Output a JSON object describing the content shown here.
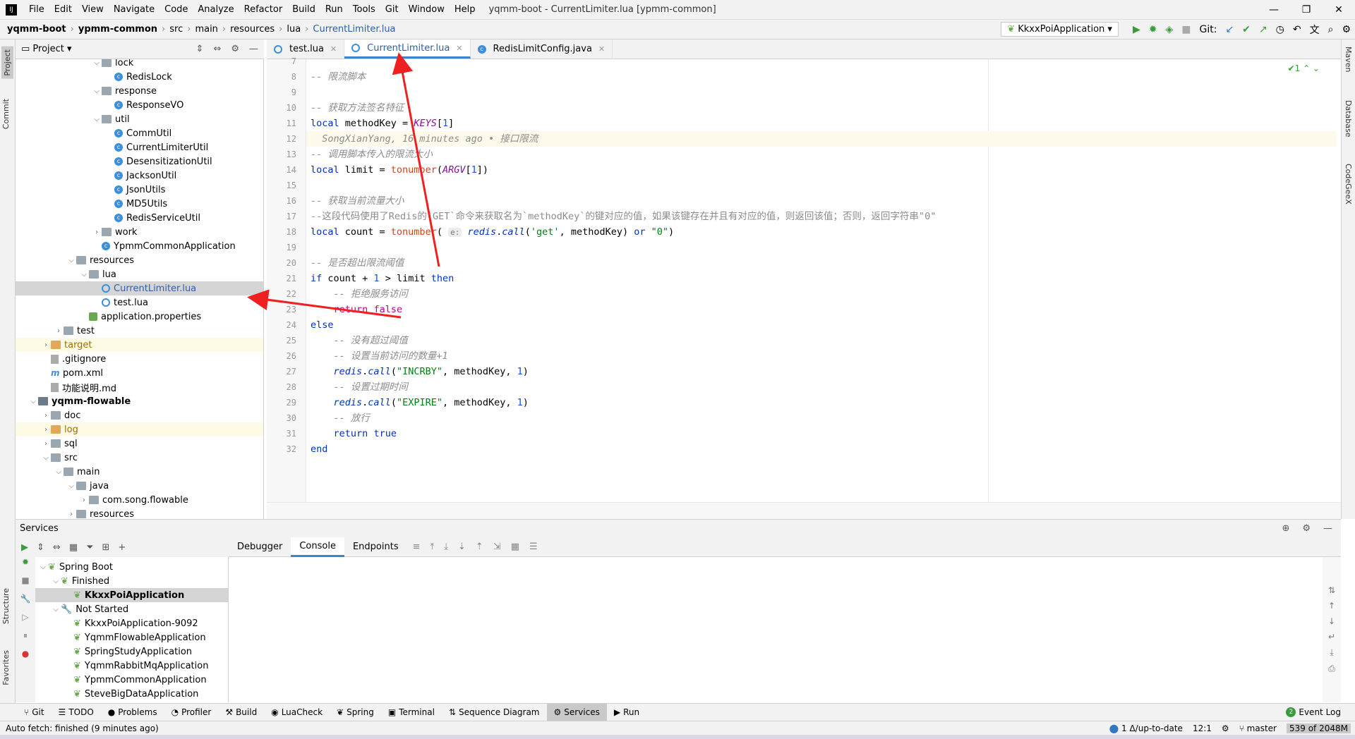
{
  "menu": {
    "items": [
      "File",
      "Edit",
      "View",
      "Navigate",
      "Code",
      "Analyze",
      "Refactor",
      "Build",
      "Run",
      "Tools",
      "Git",
      "Window",
      "Help"
    ],
    "window_title": "yqmm-boot - CurrentLimiter.lua [ypmm-common]"
  },
  "nav": {
    "crumbs": [
      "yqmm-boot",
      "ypmm-common",
      "src",
      "main",
      "resources",
      "lua",
      "CurrentLimiter.lua"
    ],
    "run_config": "KkxxPoiApplication",
    "git_label": "Git:"
  },
  "left_strip": {
    "project": "Project",
    "commit": "Commit",
    "structure": "Structure",
    "favorites": "Favorites"
  },
  "right_strip": {
    "maven": "Maven",
    "database": "Database",
    "codegeex": "CodeGeeX"
  },
  "project": {
    "title": "Project",
    "tree": [
      {
        "label": "lock",
        "type": "folder",
        "depth": 6,
        "open": true
      },
      {
        "label": "RedisLock",
        "type": "class",
        "depth": 7
      },
      {
        "label": "response",
        "type": "folder",
        "depth": 6,
        "open": true
      },
      {
        "label": "ResponseVO",
        "type": "class",
        "depth": 7
      },
      {
        "label": "util",
        "type": "folder",
        "depth": 6,
        "open": true
      },
      {
        "label": "CommUtil",
        "type": "class",
        "depth": 7
      },
      {
        "label": "CurrentLimiterUtil",
        "type": "class",
        "depth": 7
      },
      {
        "label": "DesensitizationUtil",
        "type": "class",
        "depth": 7
      },
      {
        "label": "JacksonUtil",
        "type": "class",
        "depth": 7
      },
      {
        "label": "JsonUtils",
        "type": "class",
        "depth": 7
      },
      {
        "label": "MD5Utils",
        "type": "class",
        "depth": 7
      },
      {
        "label": "RedisServiceUtil",
        "type": "class",
        "depth": 7
      },
      {
        "label": "work",
        "type": "folder",
        "depth": 6,
        "open": false
      },
      {
        "label": "YpmmCommonApplication",
        "type": "class",
        "depth": 6
      },
      {
        "label": "resources",
        "type": "folder",
        "depth": 4,
        "open": true
      },
      {
        "label": "lua",
        "type": "folder",
        "depth": 5,
        "open": true
      },
      {
        "label": "CurrentLimiter.lua",
        "type": "lua",
        "depth": 6,
        "selected": true
      },
      {
        "label": "test.lua",
        "type": "lua",
        "depth": 6
      },
      {
        "label": "application.properties",
        "type": "prop",
        "depth": 5
      },
      {
        "label": "test",
        "type": "folder",
        "depth": 3,
        "open": false
      },
      {
        "label": "target",
        "type": "folder-orange",
        "depth": 2,
        "open": false,
        "highlight": true
      },
      {
        "label": ".gitignore",
        "type": "file",
        "depth": 2
      },
      {
        "label": "pom.xml",
        "type": "maven",
        "depth": 2
      },
      {
        "label": "功能说明.md",
        "type": "file",
        "depth": 2
      },
      {
        "label": "yqmm-flowable",
        "type": "module",
        "depth": 1,
        "open": true,
        "bold": true
      },
      {
        "label": "doc",
        "type": "folder",
        "depth": 2,
        "open": false
      },
      {
        "label": "log",
        "type": "folder-orange",
        "depth": 2,
        "open": false,
        "highlight": true
      },
      {
        "label": "sql",
        "type": "folder",
        "depth": 2,
        "open": false
      },
      {
        "label": "src",
        "type": "folder",
        "depth": 2,
        "open": true
      },
      {
        "label": "main",
        "type": "folder",
        "depth": 3,
        "open": true
      },
      {
        "label": "java",
        "type": "folder",
        "depth": 4,
        "open": true
      },
      {
        "label": "com.song.flowable",
        "type": "folder",
        "depth": 5,
        "open": false
      },
      {
        "label": "resources",
        "type": "folder",
        "depth": 4,
        "open": false
      }
    ]
  },
  "editor": {
    "tabs": [
      {
        "label": "test.lua",
        "active": false
      },
      {
        "label": "CurrentLimiter.lua",
        "active": true
      },
      {
        "label": "RedisLimitConfig.java",
        "active": false
      }
    ],
    "inspection": "1",
    "lines": [
      {
        "n": "7",
        "html": ""
      },
      {
        "n": "8",
        "html": "<span class='cm'>-- 限流脚本</span>"
      },
      {
        "n": "9",
        "html": ""
      },
      {
        "n": "10",
        "html": "<span class='cm'>-- 获取方法签名特征</span>"
      },
      {
        "n": "11",
        "html": "<span class='kw'>local</span> methodKey = <span class='gl'>KEYS</span>[<span class='num'>1</span>]"
      },
      {
        "n": "12",
        "html": "<span class='cm'>  SongXianYang, 16 minutes ago • 接口限流</span>",
        "current": true
      },
      {
        "n": "13",
        "html": "<span class='cm'>-- 调用脚本传入的限流大小</span>"
      },
      {
        "n": "14",
        "html": "<span class='kw'>local</span> limit = <span class='fn'>tonumber</span>(<span class='gl'>ARGV</span>[<span class='num'>1</span>])"
      },
      {
        "n": "15",
        "html": ""
      },
      {
        "n": "16",
        "html": "<span class='cm'>-- 获取当前流量大小</span>"
      },
      {
        "n": "17",
        "html": "<span class='cm' style='font-style:normal'>--这段代码使用了Redis的`GET`命令来获取名为`methodKey`的键对应的值，如果该键存在并且有对应的值，则返回该值；否则，返回字符串\"0\"</span>"
      },
      {
        "n": "18",
        "html": "<span class='kw'>local</span> count = <span class='fn'>tonumber</span>( <span class='hint'>e:</span> <span class='rc'>redis</span>.<span class='rc'>call</span>(<span class='str'>'get'</span>, methodKey) <span class='kw'>or</span> <span class='str'>\"0\"</span>)"
      },
      {
        "n": "19",
        "html": ""
      },
      {
        "n": "20",
        "html": "<span class='cm'>-- 是否超出限流阈值</span>"
      },
      {
        "n": "21",
        "html": "<span class='kw'>if</span> count + <span class='num'>1</span> &gt; limit <span class='kw'>then</span>"
      },
      {
        "n": "22",
        "html": "    <span class='cm'>-- 拒绝服务访问</span>"
      },
      {
        "n": "23",
        "html": "    <span class='kw' style='color:#c0008c'>return</span> <span class='kw' style='color:#c0008c'>false</span>"
      },
      {
        "n": "24",
        "html": "<span class='kw'>else</span>"
      },
      {
        "n": "25",
        "html": "    <span class='cm'>-- 没有超过阈值</span>"
      },
      {
        "n": "26",
        "html": "    <span class='cm'>-- 设置当前访问的数量+1</span>"
      },
      {
        "n": "27",
        "html": "    <span class='rc'>redis</span>.<span class='rc'>call</span>(<span class='str'>\"INCRBY\"</span>, methodKey, <span class='num'>1</span>)"
      },
      {
        "n": "28",
        "html": "    <span class='cm'>-- 设置过期时间</span>"
      },
      {
        "n": "29",
        "html": "    <span class='rc'>redis</span>.<span class='rc'>call</span>(<span class='str'>\"EXPIRE\"</span>, methodKey, <span class='num'>1</span>)"
      },
      {
        "n": "30",
        "html": "    <span class='cm'>-- 放行</span>"
      },
      {
        "n": "31",
        "html": "    <span class='kw'>return</span> <span class='kw'>true</span>"
      },
      {
        "n": "32",
        "html": "<span class='kw'>end</span>"
      }
    ]
  },
  "services": {
    "title": "Services",
    "tabs": [
      {
        "label": "Debugger",
        "active": false
      },
      {
        "label": "Console",
        "active": true
      },
      {
        "label": "Endpoints",
        "active": false
      }
    ],
    "tree": [
      {
        "label": "Spring Boot",
        "depth": 0,
        "open": true
      },
      {
        "label": "Finished",
        "depth": 1,
        "open": true
      },
      {
        "label": "KkxxPoiApplication",
        "depth": 2,
        "selected": true,
        "bold": true
      },
      {
        "label": "Not Started",
        "depth": 1,
        "open": true
      },
      {
        "label": "KkxxPoiApplication-9092",
        "depth": 2
      },
      {
        "label": "YqmmFlowableApplication",
        "depth": 2
      },
      {
        "label": "SpringStudyApplication",
        "depth": 2
      },
      {
        "label": "YqmmRabbitMqApplication",
        "depth": 2
      },
      {
        "label": "YpmmCommonApplication",
        "depth": 2
      },
      {
        "label": "SteveBigDataApplication",
        "depth": 2
      }
    ]
  },
  "tool_windows": {
    "items": [
      {
        "label": "Git",
        "icon": "⑂"
      },
      {
        "label": "TODO",
        "icon": "☰"
      },
      {
        "label": "Problems",
        "icon": "●"
      },
      {
        "label": "Profiler",
        "icon": "◔"
      },
      {
        "label": "Build",
        "icon": "⚒"
      },
      {
        "label": "LuaCheck",
        "icon": "◉"
      },
      {
        "label": "Spring",
        "icon": "❦"
      },
      {
        "label": "Terminal",
        "icon": "▣"
      },
      {
        "label": "Sequence Diagram",
        "icon": "⇅"
      },
      {
        "label": "Services",
        "icon": "⚙",
        "active": true
      },
      {
        "label": "Run",
        "icon": "▶"
      }
    ],
    "event_log": "Event Log",
    "event_count": "2"
  },
  "status": {
    "message": "Auto fetch: finished (9 minutes ago)",
    "vcs": "1 Δ/up-to-date",
    "position": "12:1",
    "branch": "master",
    "memory": "539 of 2048M"
  },
  "colors": {
    "accent": "#4083c9",
    "annotation_arrow": "#f02020"
  }
}
